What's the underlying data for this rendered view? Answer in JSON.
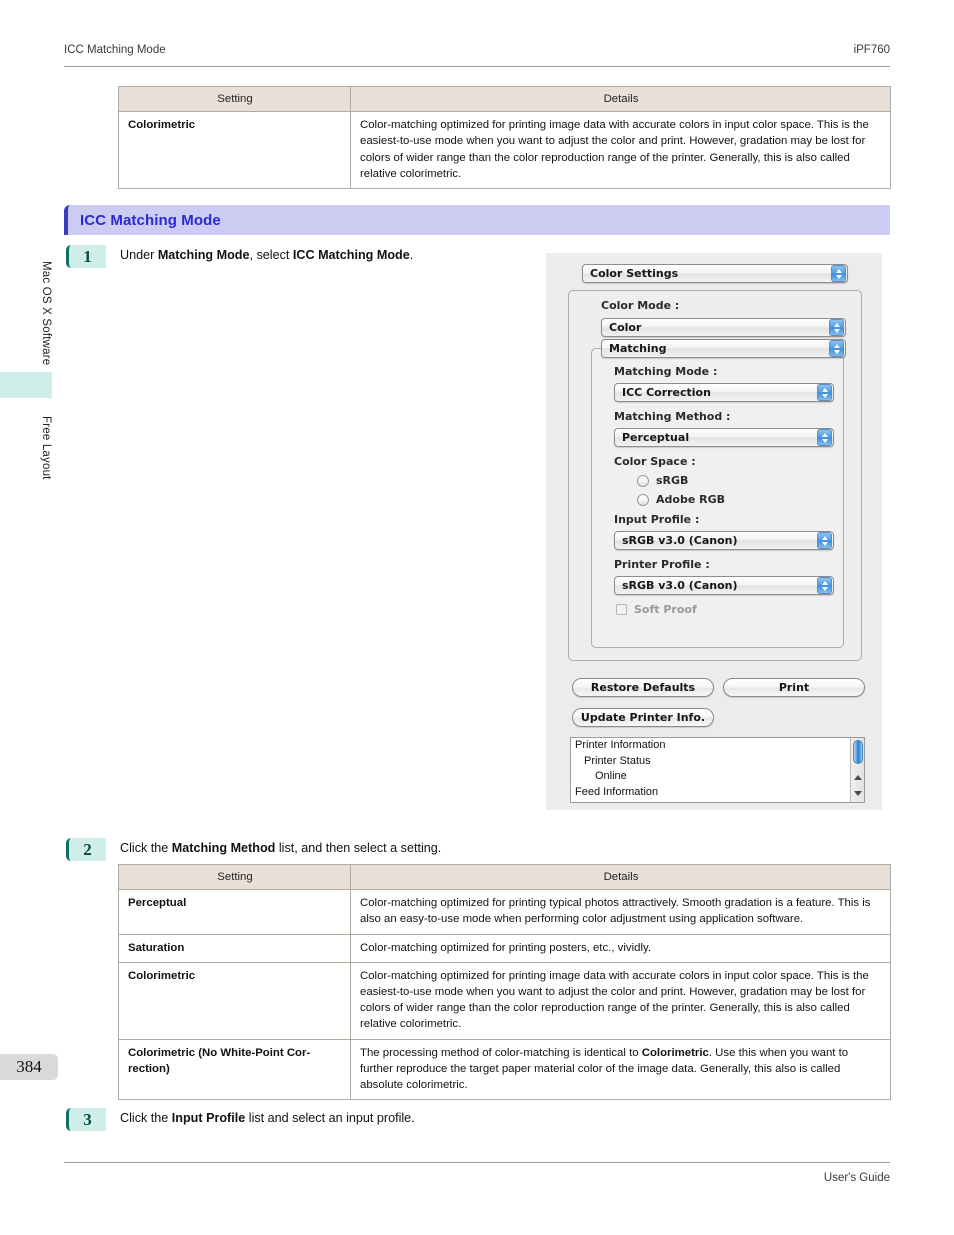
{
  "header": {
    "left": "ICC Matching Mode",
    "right": "iPF760"
  },
  "footer": {
    "right": "User's Guide"
  },
  "sidebar": {
    "tabs": [
      {
        "label": "Mac OS X Software"
      },
      {
        "label": "Free Layout"
      }
    ],
    "page_number": "384"
  },
  "table_top": {
    "headers": {
      "setting": "Setting",
      "details": "Details"
    },
    "rows": [
      {
        "setting": "Colorimetric",
        "details": "Color-matching optimized for printing image data with accurate colors in input color space. This is the easiest-to-use mode when you want to adjust the color and print. However, gradation may be lost for colors of wider range than the color reproduction range of the printer. Generally, this is also called relative colorimetric."
      }
    ]
  },
  "section": {
    "title": "ICC Matching Mode"
  },
  "steps": {
    "step1": {
      "number": "1",
      "text_parts": [
        "Under ",
        "Matching Mode",
        ", select ",
        "ICC Matching Mode",
        "."
      ]
    },
    "step2": {
      "number": "2",
      "text_parts": [
        "Click the ",
        "Matching Method",
        " list, and then select a setting."
      ]
    },
    "step3": {
      "number": "3",
      "text_parts": [
        "Click the ",
        "Input Profile",
        " list and select an input profile."
      ]
    }
  },
  "table_bottom": {
    "headers": {
      "setting": "Setting",
      "details": "Details"
    },
    "rows": [
      {
        "setting": "Perceptual",
        "details": "Color-matching optimized for printing typical photos attractively. Smooth gradation is a feature. This is also an easy-to-use mode when performing color adjustment using application software."
      },
      {
        "setting": "Saturation",
        "details": "Color-matching optimized for printing posters, etc., vividly."
      },
      {
        "setting": "Colorimetric",
        "details": "Color-matching optimized for printing image data with accurate colors in input color space. This is the easiest-to-use mode when you want to adjust the color and print. However, gradation may be lost for colors of wider range than the color reproduction range of the printer. Generally, this is also called relative colorimetric."
      },
      {
        "setting": "Colorimetric (No White-Point Cor-rection)",
        "details_before": "The processing method of color-matching is identical to ",
        "details_bold": "Colorimetric",
        "details_after": ". Use this when you want to further reproduce the target paper material color of the image data. Generally, this also is called absolute colorimetric."
      }
    ]
  },
  "dialog": {
    "panel_popup": "Color Settings",
    "color_mode_label": "Color Mode :",
    "color_mode_value": "Color",
    "matching_popup": "Matching",
    "matching_mode_label": "Matching Mode :",
    "matching_mode_value": "ICC Correction",
    "matching_method_label": "Matching Method :",
    "matching_method_value": "Perceptual",
    "color_space_label": "Color Space :",
    "color_space_options": [
      "sRGB",
      "Adobe RGB"
    ],
    "input_profile_label": "Input Profile :",
    "input_profile_value": "sRGB v3.0 (Canon)",
    "printer_profile_label": "Printer Profile :",
    "printer_profile_value": "sRGB v3.0 (Canon)",
    "soft_proof_label": "Soft Proof",
    "buttons": {
      "restore_defaults": "Restore Defaults",
      "print": "Print",
      "update_printer_info": "Update Printer Info."
    },
    "printer_info_rows": [
      "Printer Information",
      "Printer Status",
      "Online",
      "Feed Information"
    ]
  },
  "colors": {
    "section_bar_bg": "#ccccf2",
    "section_bar_text": "#2a2ad1",
    "section_bar_border": "#3b3bbd",
    "step_badge_bg": "#cfeeea",
    "step_badge_border": "#0d6e63",
    "table_header_bg": "#e9e1d9",
    "table_border": "#b3aaa2",
    "sidebar_highlight": "#cfeeea",
    "page_number_bg": "#d9d9d9"
  }
}
